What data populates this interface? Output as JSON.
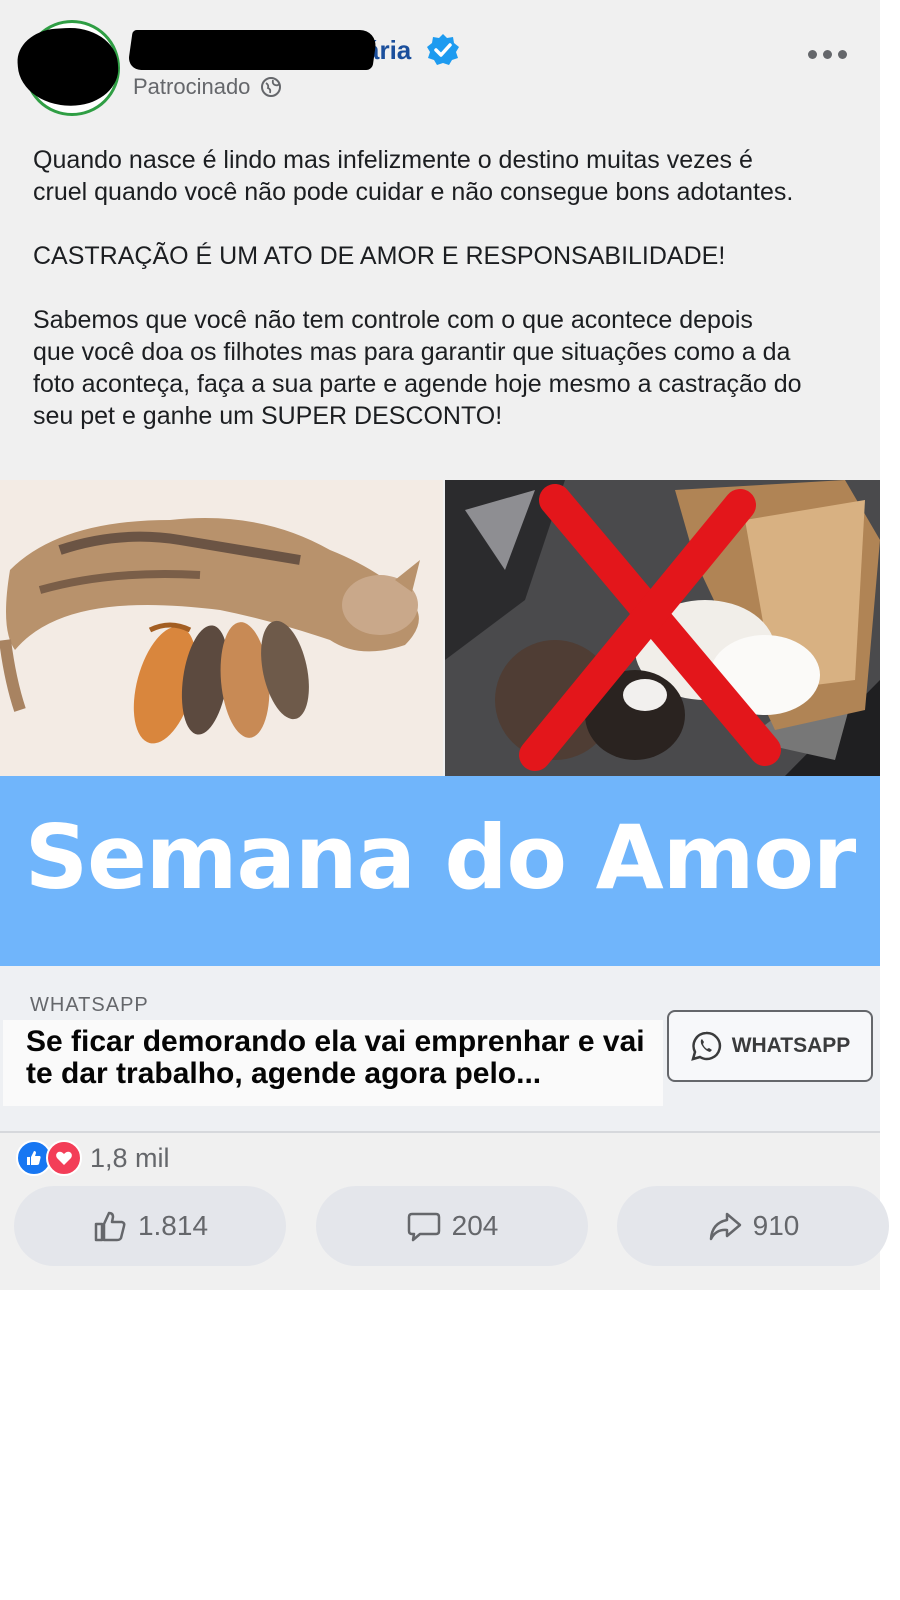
{
  "post": {
    "page_name_visible": "ária",
    "sponsored_label": "Patrocinado",
    "icons": [
      "verified-badge-icon",
      "globe-icon",
      "more-options-icon"
    ],
    "body_paragraphs": [
      "Quando nasce é lindo mas infelizmente o destino muitas vezes é\ncruel quando você não pode cuidar e não consegue bons adotantes.",
      "CASTRAÇÃO É UM ATO DE AMOR E RESPONSABILIDADE!",
      "Sabemos que você não tem controle com o que acontece depois\nque você doa os filhotes mas para garantir que situações como a da\nfoto aconteça, faça a sua parte e agende hoje mesmo a castração do\nseu pet e ganhe um SUPER DESCONTO!"
    ]
  },
  "banner": {
    "title": "Semana do Amor",
    "background_color": "#70b5fb"
  },
  "cta": {
    "source": "WHATSAPP",
    "headline": "Se ficar demorando ela vai emprenhar e vai te dar trabalho, agende agora pelo...",
    "button_label": "WHATSAPP",
    "button_icon": "whatsapp-icon"
  },
  "reactions": {
    "count": "1,8 mil",
    "types": [
      "like",
      "love"
    ]
  },
  "actions": {
    "like_count": "1.814",
    "comment_count": "204",
    "share_count": "910"
  },
  "colors": {
    "brand_blue": "#1877f2",
    "love_red": "#f33e58",
    "verified_blue": "#1d9bf0",
    "cross_red": "#e3161b"
  }
}
